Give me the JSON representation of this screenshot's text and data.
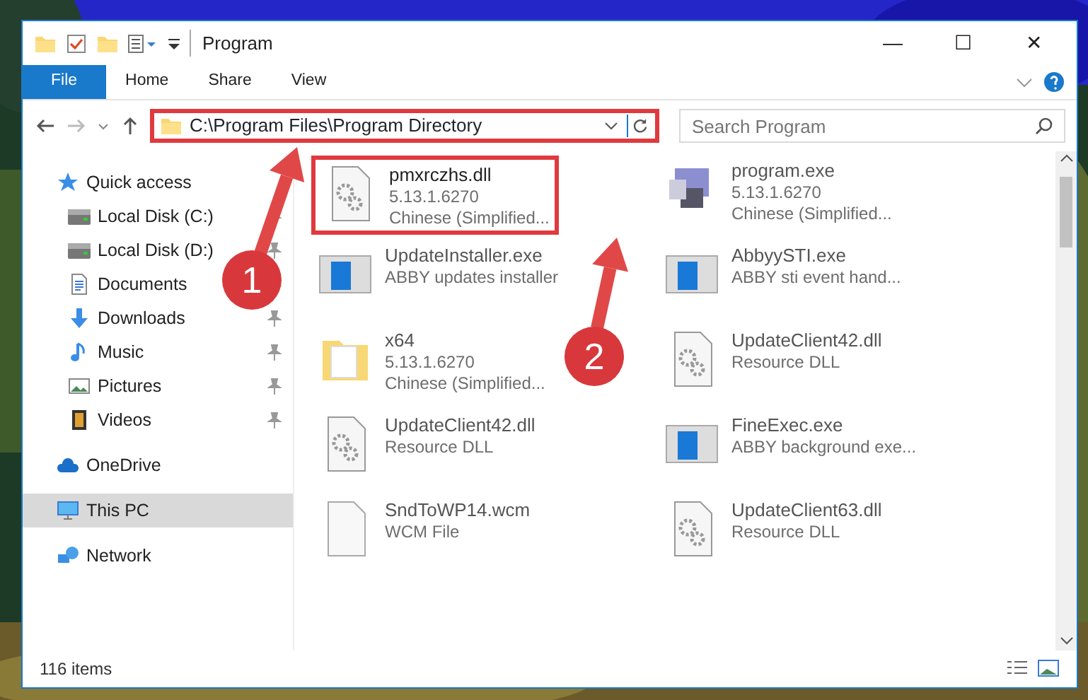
{
  "window": {
    "title": "Program",
    "controls": [
      "—",
      "☐",
      "✕"
    ]
  },
  "ribbon": {
    "tabs": [
      {
        "label": "File",
        "selected": true
      },
      {
        "label": "Home",
        "selected": false
      },
      {
        "label": "Share",
        "selected": false
      },
      {
        "label": "View",
        "selected": false
      }
    ]
  },
  "address_bar": {
    "path": "C:\\Program Files\\Program Directory",
    "highlighted": true
  },
  "search": {
    "placeholder": "Search Program"
  },
  "sidebar": {
    "items": [
      {
        "label": "Quick access",
        "selected": false,
        "pinned": false,
        "children": [
          {
            "label": "Local Disk (C:)",
            "selected": false,
            "pinned": true
          },
          {
            "label": "Local Disk (D:)",
            "selected": false,
            "pinned": true
          },
          {
            "label": "Documents",
            "selected": false,
            "pinned": true
          },
          {
            "label": "Downloads",
            "selected": false,
            "pinned": true
          },
          {
            "label": "Music",
            "selected": false,
            "pinned": true
          },
          {
            "label": "Pictures",
            "selected": false,
            "pinned": true
          },
          {
            "label": "Videos",
            "selected": false,
            "pinned": true
          }
        ]
      },
      {
        "label": "OneDrive",
        "selected": false,
        "pinned": false
      },
      {
        "label": "This PC",
        "selected": true,
        "pinned": false
      },
      {
        "label": "Network",
        "selected": false,
        "pinned": false
      }
    ]
  },
  "files": [
    {
      "name": "pmxrczhs.dll",
      "details": [
        "5.13.1.6270",
        "Chinese (Simplified..."
      ],
      "kind": "library",
      "highlighted": true
    },
    {
      "name": "program.exe",
      "details": [
        "5.13.1.6270",
        "Chinese (Simplified..."
      ],
      "kind": "installer",
      "highlighted": false
    },
    {
      "name": "UpdateInstaller.exe",
      "details": [
        "ABBY updates installer"
      ],
      "kind": "application",
      "highlighted": false
    },
    {
      "name": "AbbyySTI.exe",
      "details": [
        "ABBY sti event hand..."
      ],
      "kind": "application",
      "highlighted": false
    },
    {
      "name": "x64",
      "details": [
        "5.13.1.6270",
        "Chinese (Simplified..."
      ],
      "kind": "folder",
      "highlighted": false
    },
    {
      "name": "UpdateClient42.dll",
      "details": [
        "Resource DLL"
      ],
      "kind": "library",
      "highlighted": false
    },
    {
      "name": "UpdateClient42.dll",
      "details": [
        "Resource DLL"
      ],
      "kind": "library",
      "highlighted": false
    },
    {
      "name": "FineExec.exe",
      "details": [
        "ABBY background exe..."
      ],
      "kind": "application",
      "highlighted": false
    },
    {
      "name": "SndToWP14.wcm",
      "details": [
        "WCM File"
      ],
      "kind": "file",
      "highlighted": false
    },
    {
      "name": "UpdateClient63.dll",
      "details": [
        "Resource DLL"
      ],
      "kind": "library",
      "highlighted": false
    }
  ],
  "status_bar": {
    "count": "116 items"
  },
  "annotations": [
    {
      "number": "1"
    },
    {
      "number": "2"
    }
  ]
}
